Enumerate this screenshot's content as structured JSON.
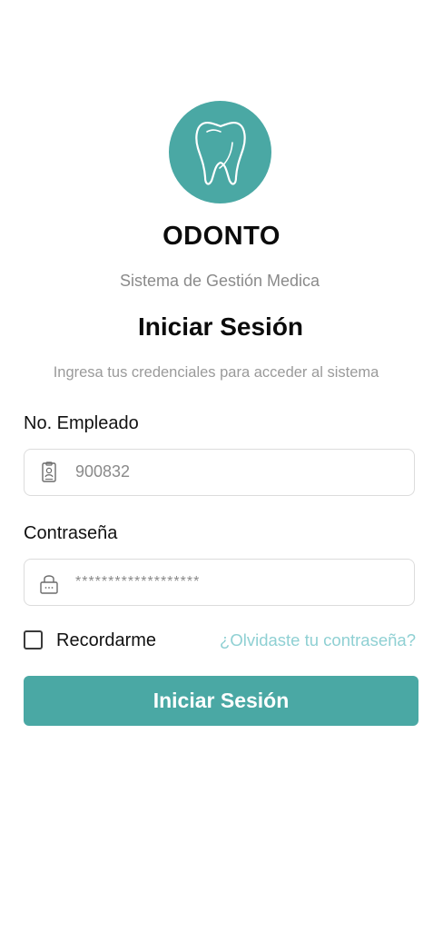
{
  "brand": {
    "logo_icon": "tooth-icon",
    "name": "ODONTO",
    "subtitle": "Sistema de Gestión Medica",
    "accent_color": "#4aa8a4"
  },
  "login": {
    "title": "Iniciar Sesión",
    "subtitle": "Ingresa tus credenciales para acceder al sistema"
  },
  "employee_field": {
    "label": "No. Empleado",
    "icon": "id-badge-icon",
    "value": "900832"
  },
  "password_field": {
    "label": "Contraseña",
    "icon": "lock-icon",
    "value": "*******************"
  },
  "remember": {
    "label": "Recordarme",
    "checked": false
  },
  "forgot_link": "¿Olvidaste tu contraseña?",
  "submit_label": "Iniciar Sesión"
}
